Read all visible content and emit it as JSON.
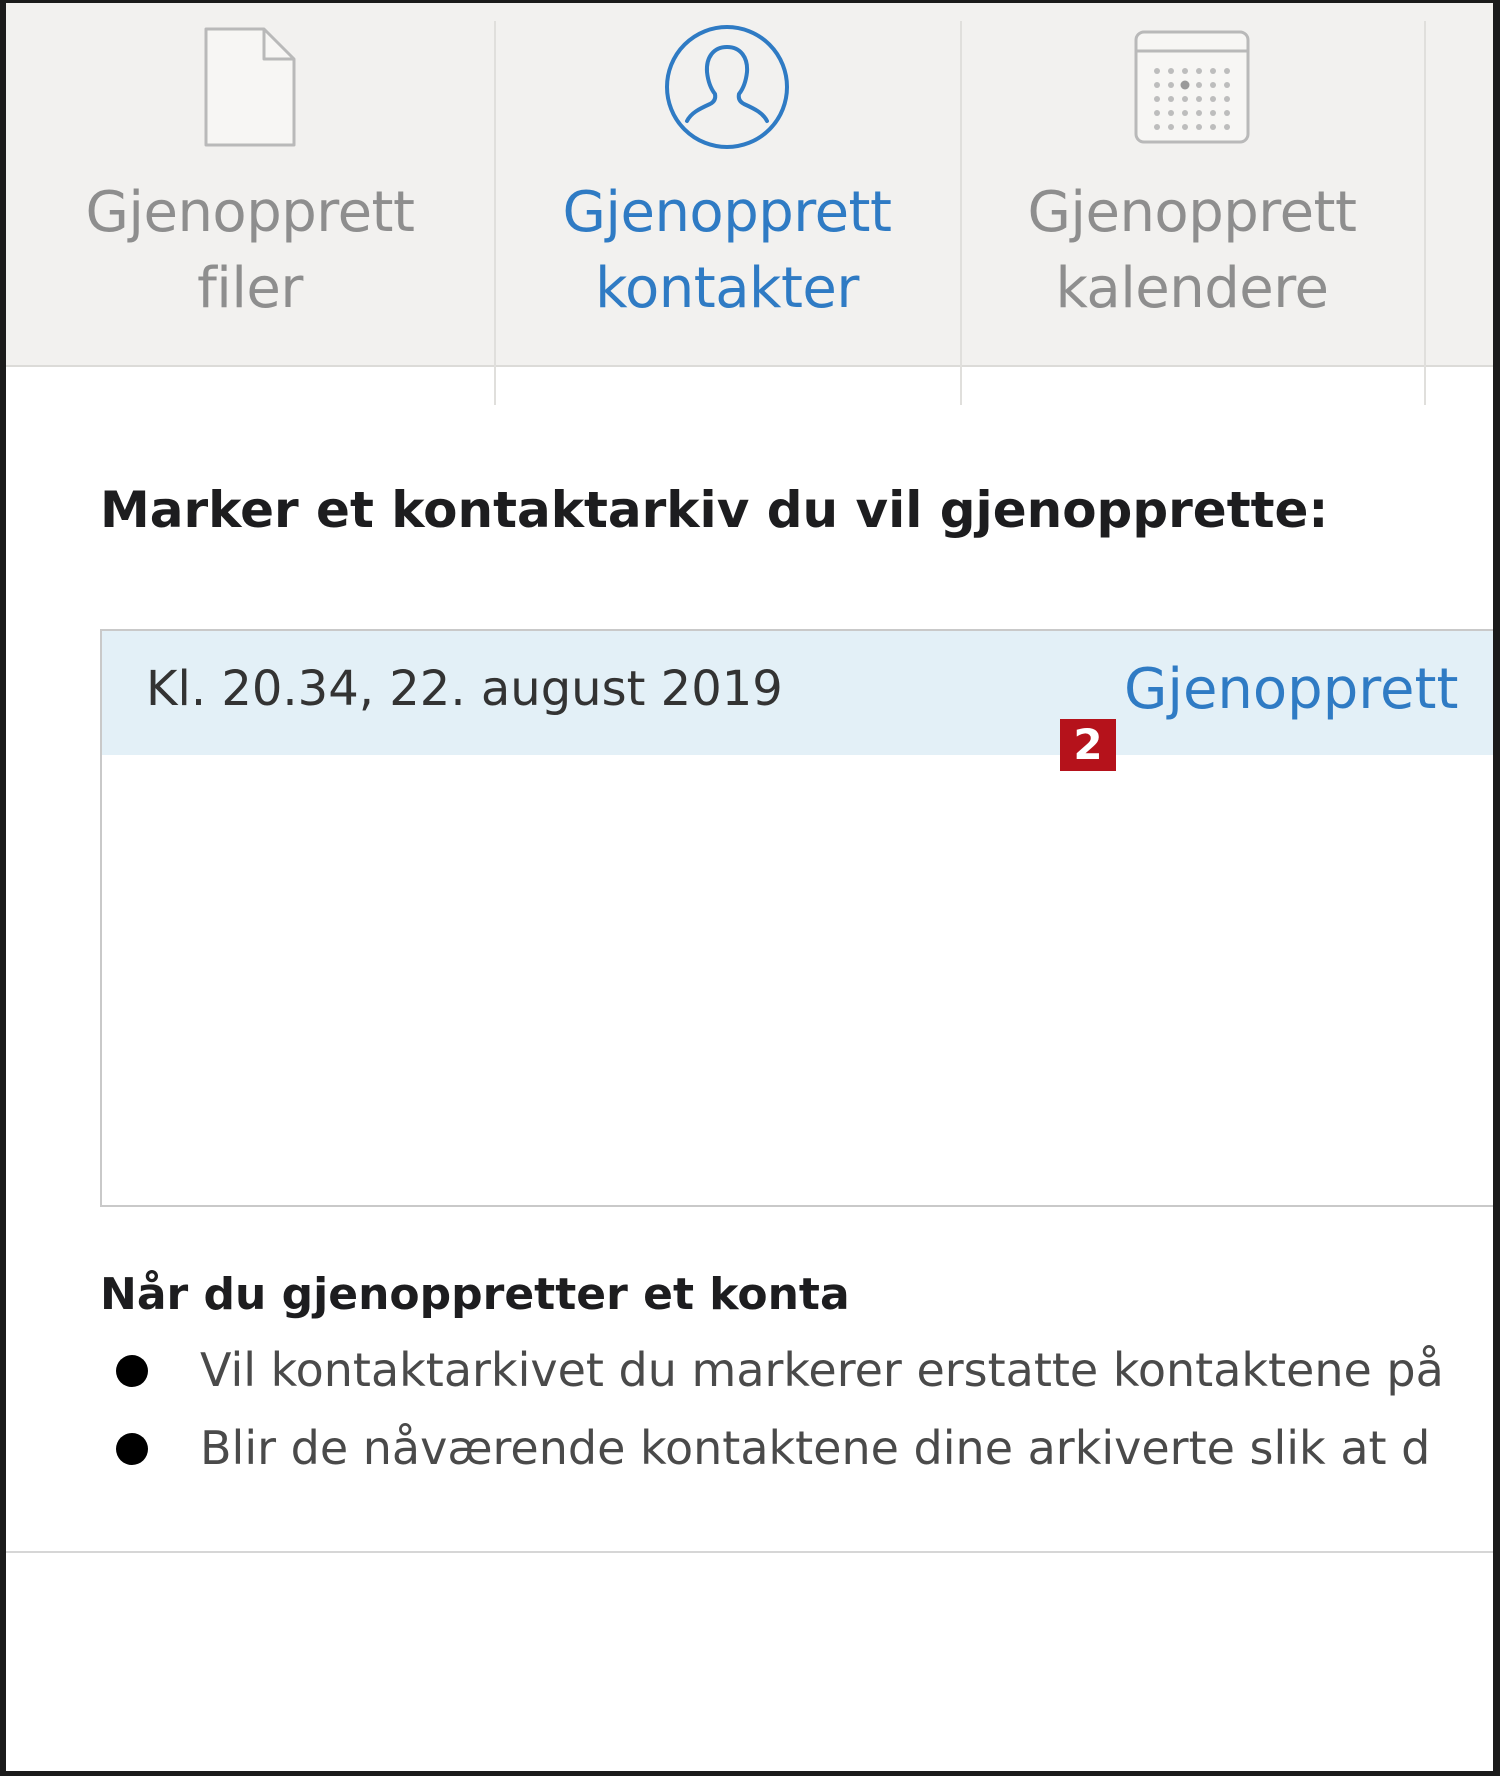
{
  "tabs": [
    {
      "id": "files",
      "line1": "Gjenopprett",
      "line2": "filer",
      "icon": "document-icon",
      "active": false
    },
    {
      "id": "contacts",
      "line1": "Gjenopprett",
      "line2": "kontakter",
      "icon": "contact-person-icon",
      "active": true
    },
    {
      "id": "calendars",
      "line1": "Gjenopprett",
      "line2": "kalendere",
      "icon": "calendar-icon",
      "active": false
    }
  ],
  "main": {
    "heading": "Marker et kontaktarkiv du vil gjenopprette:",
    "archives": [
      {
        "date": "Kl. 20.34, 22. august 2019",
        "action": "Gjenopprett"
      }
    ],
    "step_badge": "2",
    "note_heading": "Når du gjenoppretter et konta",
    "bullets": [
      "Vil kontaktarkivet du markerer erstatte kontaktene på",
      "Blir de nåværende kontaktene dine arkiverte slik at d"
    ]
  },
  "colors": {
    "accent": "#2f7bc4",
    "inactive_text": "#8e8e8e",
    "selected_row": "#e3f0f7",
    "badge": "#b5121b",
    "tabbar_bg": "#f2f1ef"
  }
}
